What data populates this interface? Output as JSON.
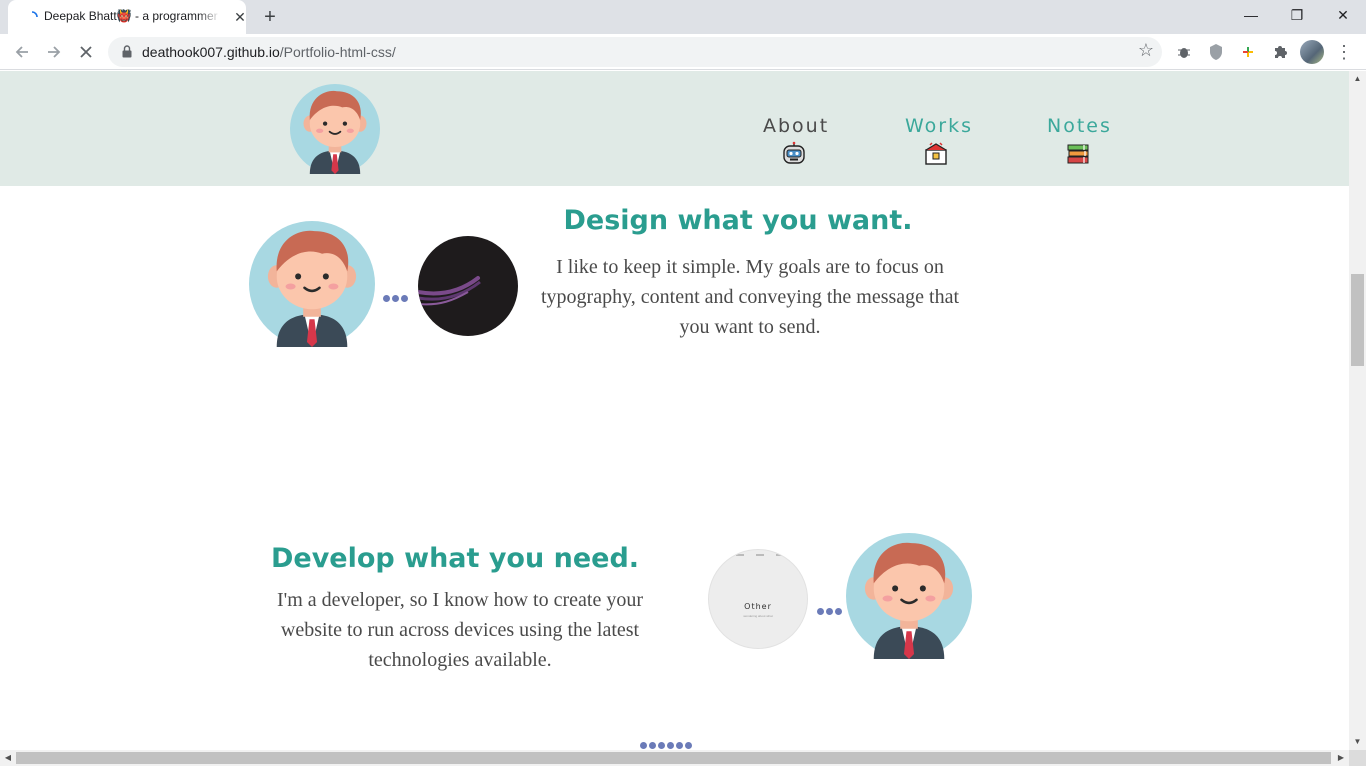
{
  "browser": {
    "tab_title": "Deepak Bhatt👹 - a programmer",
    "tab_close": "✕",
    "new_tab": "+",
    "url_host": "deathook007.github.io",
    "url_path": "/Portfolio-html-css/",
    "window_min": "—",
    "window_max": "❐",
    "window_close": "✕"
  },
  "nav": {
    "items": [
      {
        "label": "About",
        "emoji": "robot-face-icon"
      },
      {
        "label": "Works",
        "emoji": "briefcase-icon"
      },
      {
        "label": "Notes",
        "emoji": "books-icon"
      }
    ]
  },
  "section_design": {
    "heading": "Design what you want.",
    "text": "I like to keep it simple. My goals are to focus on typography, content and conveying the message that you want to send."
  },
  "section_develop": {
    "heading": "Develop what you need.",
    "text": "I'm a developer, so I know how to create your website to run across devices using the latest technologies available.",
    "preview_title": "Other",
    "preview_subtitle": "wondering about what"
  },
  "colors": {
    "header_bg": "#e0eae6",
    "accent": "#2a9d8f",
    "dots": "#6b7bb8",
    "text": "#4a4a4a"
  }
}
